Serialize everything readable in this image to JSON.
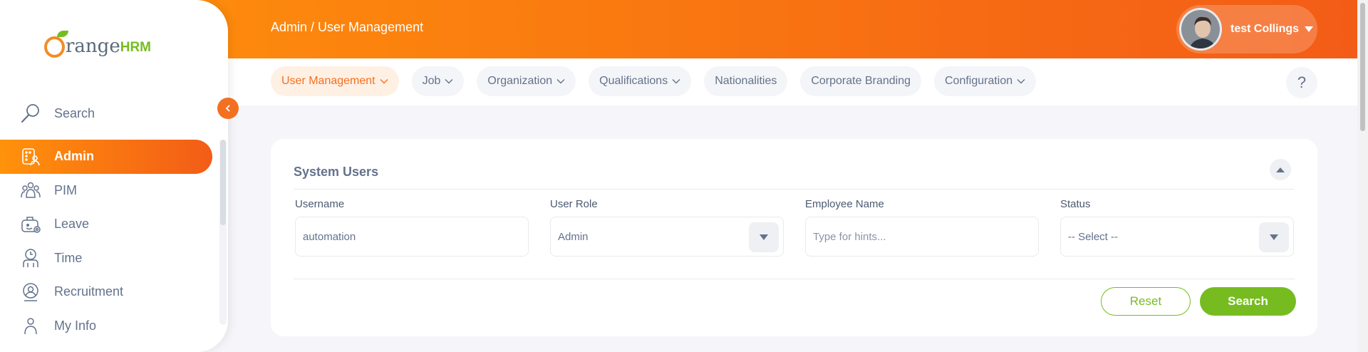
{
  "brand": {
    "part1": "range",
    "part2": "HRM"
  },
  "breadcrumb": "Admin / User Management",
  "user": {
    "name": "test Collings"
  },
  "sidebar": {
    "search_label": "Search",
    "items": [
      {
        "label": "Admin",
        "icon": "admin-icon",
        "active": true
      },
      {
        "label": "PIM",
        "icon": "pim-icon"
      },
      {
        "label": "Leave",
        "icon": "leave-icon"
      },
      {
        "label": "Time",
        "icon": "time-icon"
      },
      {
        "label": "Recruitment",
        "icon": "recruitment-icon"
      },
      {
        "label": "My Info",
        "icon": "my-info-icon"
      }
    ]
  },
  "tabs": [
    {
      "label": "User Management",
      "dropdown": true,
      "active": true
    },
    {
      "label": "Job",
      "dropdown": true
    },
    {
      "label": "Organization",
      "dropdown": true
    },
    {
      "label": "Qualifications",
      "dropdown": true
    },
    {
      "label": "Nationalities",
      "dropdown": false
    },
    {
      "label": "Corporate Branding",
      "dropdown": false
    },
    {
      "label": "Configuration",
      "dropdown": true
    }
  ],
  "help_label": "?",
  "filter": {
    "title": "System Users",
    "username": {
      "label": "Username",
      "value": "automation"
    },
    "user_role": {
      "label": "User Role",
      "value": "Admin"
    },
    "employee_name": {
      "label": "Employee Name",
      "placeholder": "Type for hints..."
    },
    "status": {
      "label": "Status",
      "value": "-- Select --"
    },
    "reset_label": "Reset",
    "search_label": "Search"
  },
  "colors": {
    "accent": "#f37021",
    "gradient_start": "#ff920b",
    "gradient_end": "#f35c17",
    "success": "#76bc21"
  }
}
